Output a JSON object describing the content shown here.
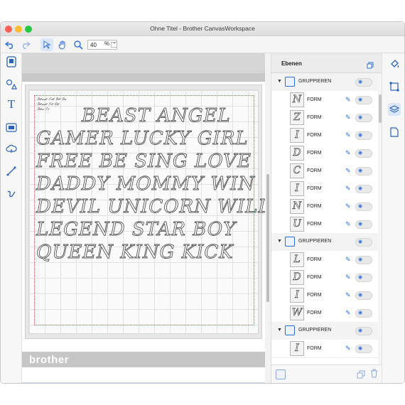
{
  "window": {
    "title": "Ohne Titel - Brother CanvasWorkspace"
  },
  "toolbar": {
    "undo_icon": "undo-icon",
    "redo_icon": "redo-icon",
    "select_icon": "select-arrow-icon",
    "hand_icon": "hand-icon",
    "zoom_icon": "zoom-icon",
    "zoom_value": "40",
    "zoom_unit": "%"
  },
  "canvas": {
    "tiny_rows": [
      "ℬℯ𝒶𝓈ℯ ℱ𝒾ℯ ℬℯ ℬ𝒶",
      "ℬℯ𝒶𝓈ℯ ℱℯ ℬℯ",
      "ℬℯ𝒶 ℱ𝒾"
    ],
    "word_rows": [
      "BEAST  ANGEL",
      "GAMER LUCKY GIRL",
      "FREE BE SING LOVE",
      "DADDY MOMMY  WIN",
      "DEVIL UNICORN WILD",
      "LEGEND  STAR  BOY",
      "QUEEN  KING  KICK"
    ],
    "brand": "brother"
  },
  "layers": {
    "title": "Ebenen",
    "rows": [
      {
        "type": "group",
        "label": "GRUPPIEREN"
      },
      {
        "type": "form",
        "label": "FORM",
        "glyph": "N"
      },
      {
        "type": "form",
        "label": "FORM",
        "glyph": "Z"
      },
      {
        "type": "form",
        "label": "FORM",
        "glyph": "I"
      },
      {
        "type": "form",
        "label": "FORM",
        "glyph": "D"
      },
      {
        "type": "form",
        "label": "FORM",
        "glyph": "C"
      },
      {
        "type": "form",
        "label": "FORM",
        "glyph": "I"
      },
      {
        "type": "form",
        "label": "FORM",
        "glyph": "N"
      },
      {
        "type": "form",
        "label": "FORM",
        "glyph": "U"
      },
      {
        "type": "group",
        "label": "GRUPPIEREN"
      },
      {
        "type": "form",
        "label": "FORM",
        "glyph": "L"
      },
      {
        "type": "form",
        "label": "FORM",
        "glyph": "D"
      },
      {
        "type": "form",
        "label": "FORM",
        "glyph": "I"
      },
      {
        "type": "form",
        "label": "FORM",
        "glyph": "W"
      },
      {
        "type": "group",
        "label": "GRUPPIEREN"
      },
      {
        "type": "form",
        "label": "FORM",
        "glyph": "I"
      }
    ]
  },
  "colors": {
    "accent": "#2f6fd6",
    "mat": "#e7e7e7",
    "brand_bar": "#c6c6c6"
  }
}
